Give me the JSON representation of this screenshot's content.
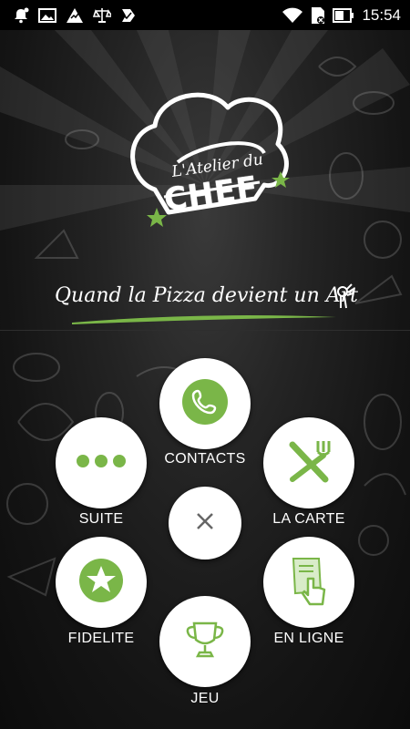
{
  "status_bar": {
    "time": "15:54",
    "left_icons": [
      "notification-bell-icon",
      "gallery-icon",
      "alert-icon",
      "scale-icon",
      "check-icon"
    ],
    "right_icons": [
      "wifi-icon",
      "sim-icon",
      "battery-icon"
    ]
  },
  "brand": {
    "logo_line1": "L'Atelier du",
    "logo_line2": "CHEF",
    "tagline": "Quand la Pizza devient un Art",
    "accent_color": "#7ab648"
  },
  "menu": {
    "contacts": {
      "label": "CONTACTS",
      "icon": "phone-icon"
    },
    "suite": {
      "label": "SUITE",
      "icon": "more-dots-icon"
    },
    "la_carte": {
      "label": "LA CARTE",
      "icon": "fork-knife-icon"
    },
    "close": {
      "icon": "close-icon"
    },
    "fidelite": {
      "label": "FIDELITE",
      "icon": "star-icon"
    },
    "en_ligne": {
      "label": "EN LIGNE",
      "icon": "tap-order-icon"
    },
    "jeu": {
      "label": "JEU",
      "icon": "trophy-icon"
    }
  }
}
